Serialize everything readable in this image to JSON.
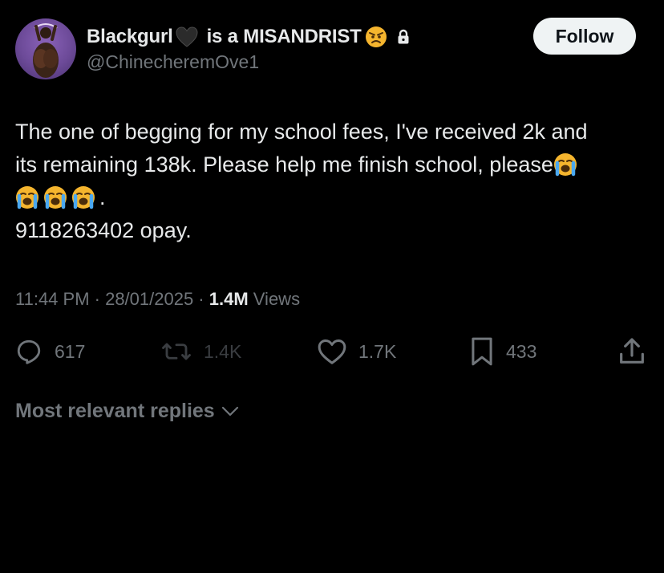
{
  "tweet": {
    "author": {
      "display_name_part1": "Blackgurl",
      "display_name_part2": "is a MISANDRIST",
      "handle": "@ChinecheremOve1",
      "name_icons": [
        "black-heart-icon",
        "angry-face-icon",
        "lock-icon"
      ]
    },
    "follow_label": "Follow",
    "text_lines": [
      "The one of begging for my school fees, I've received 2k and",
      "its remaining 138k. Please help me finish school, please",
      ".",
      "9118263402 opay."
    ],
    "emoji": "loudly-crying-face-icon",
    "timestamp": "11:44 PM · 28/01/2025 · ",
    "views_count": "1.4M",
    "views_label": " Views",
    "actions": {
      "replies": "617",
      "reposts": "1.4K",
      "likes": "1.7K",
      "bookmarks": "433"
    }
  },
  "replies_sort_label": "Most relevant replies",
  "colors": {
    "background": "#000000",
    "text_primary": "#e7e9ea",
    "text_secondary": "#71767b",
    "follow_bg": "#eff3f4"
  }
}
